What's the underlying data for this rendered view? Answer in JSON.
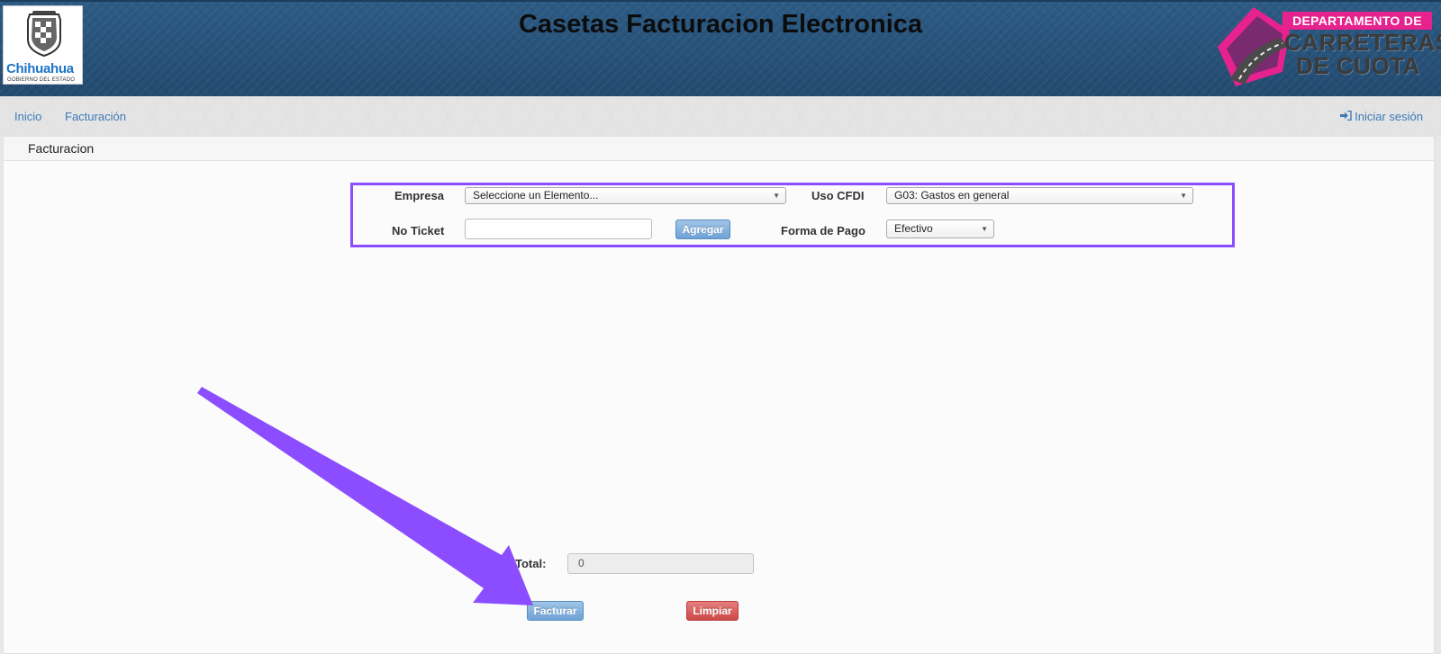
{
  "header": {
    "title": "Casetas Facturacion Electronica",
    "left_logo": {
      "name": "Chihuahua",
      "subtitle": "GOBIERNO DEL ESTADO"
    },
    "right_logo": {
      "line1": "DEPARTAMENTO DE",
      "line2": "CARRETERAS",
      "line3": "DE CUOTA"
    }
  },
  "nav": {
    "items": [
      {
        "label": "Inicio"
      },
      {
        "label": "Facturación"
      }
    ],
    "login_label": "Iniciar sesión"
  },
  "panel": {
    "title": "Facturacion"
  },
  "form": {
    "empresa_label": "Empresa",
    "empresa_value": "Seleccione un Elemento...",
    "uso_cfdi_label": "Uso CFDI",
    "uso_cfdi_value": "G03: Gastos en general",
    "no_ticket_label": "No Ticket",
    "no_ticket_value": "",
    "agregar_label": "Agregar",
    "forma_pago_label": "Forma de Pago",
    "forma_pago_value": "Efectivo"
  },
  "summary": {
    "total_label": "Total:",
    "total_value": "0",
    "facturar_label": "Facturar",
    "limpiar_label": "Limpiar"
  },
  "colors": {
    "header_bg": "#27527a",
    "highlight": "#8b4dff",
    "link": "#3f7ab8",
    "brand_pink": "#e5228e"
  }
}
